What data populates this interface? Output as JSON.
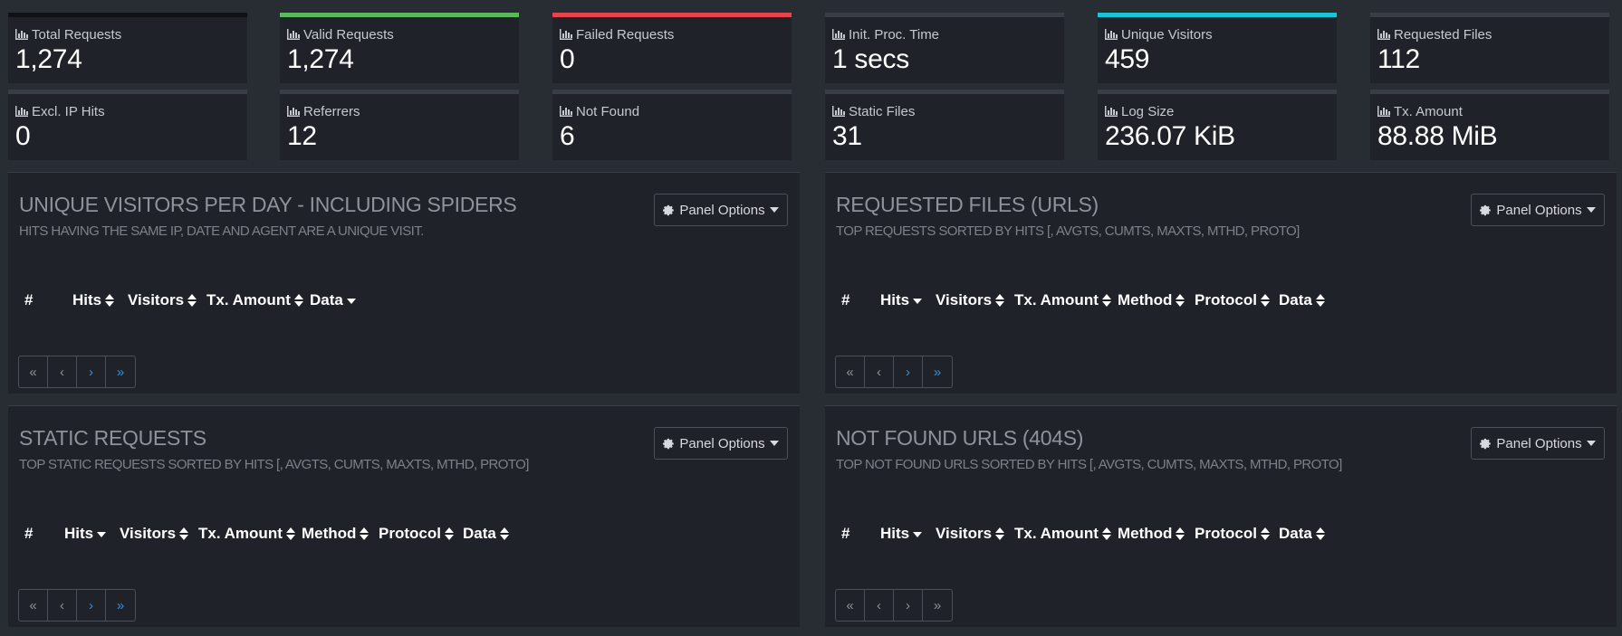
{
  "tiles_left": [
    {
      "label": "Total Requests",
      "value": "1,274",
      "accent": "#0f1115"
    },
    {
      "label": "Valid Requests",
      "value": "1,274",
      "accent": "#5cb85c"
    },
    {
      "label": "Failed Requests",
      "value": "0",
      "accent": "#e8434a"
    },
    {
      "label": "Excl. IP Hits",
      "value": "0",
      "accent": "#393e46"
    },
    {
      "label": "Referrers",
      "value": "12",
      "accent": "#393e46"
    },
    {
      "label": "Not Found",
      "value": "6",
      "accent": "#393e46"
    }
  ],
  "tiles_right": [
    {
      "label": "Init. Proc. Time",
      "value": "1 secs",
      "accent": "#393e46"
    },
    {
      "label": "Unique Visitors",
      "value": "459",
      "accent": "#17c4d9"
    },
    {
      "label": "Requested Files",
      "value": "112",
      "accent": "#393e46"
    },
    {
      "label": "Static Files",
      "value": "31",
      "accent": "#393e46"
    },
    {
      "label": "Log Size",
      "value": "236.07 KiB",
      "accent": "#393e46"
    },
    {
      "label": "Tx. Amount",
      "value": "88.88 MiB",
      "accent": "#393e46"
    }
  ],
  "panels": {
    "visitors": {
      "title": "UNIQUE VISITORS PER DAY - INCLUDING SPIDERS",
      "subtitle": "HITS HAVING THE SAME IP, DATE AND AGENT ARE A UNIQUE VISIT.",
      "options_label": "Panel Options",
      "columns": [
        "#",
        "Hits",
        "Visitors",
        "Tx. Amount",
        "Data"
      ]
    },
    "requests": {
      "title": "REQUESTED FILES (URLS)",
      "subtitle": "TOP REQUESTS SORTED BY HITS [, AVGTS, CUMTS, MAXTS, MTHD, PROTO]",
      "options_label": "Panel Options",
      "columns": [
        "#",
        "Hits",
        "Visitors",
        "Tx. Amount",
        "Method",
        "Protocol",
        "Data"
      ]
    },
    "static": {
      "title": "STATIC REQUESTS",
      "subtitle": "TOP STATIC REQUESTS SORTED BY HITS [, AVGTS, CUMTS, MAXTS, MTHD, PROTO]",
      "options_label": "Panel Options",
      "columns": [
        "#",
        "Hits",
        "Visitors",
        "Tx. Amount",
        "Method",
        "Protocol",
        "Data"
      ]
    },
    "not_found": {
      "title": "NOT FOUND URLS (404S)",
      "subtitle": "TOP NOT FOUND URLS SORTED BY HITS [, AVGTS, CUMTS, MAXTS, MTHD, PROTO]",
      "options_label": "Panel Options",
      "columns": [
        "#",
        "Hits",
        "Visitors",
        "Tx. Amount",
        "Method",
        "Protocol",
        "Data"
      ]
    }
  },
  "pager": {
    "first": "«",
    "prev": "‹",
    "next": "›",
    "last": "»"
  },
  "icons": {
    "tile": "bar-chart-icon",
    "options": "gear-icon",
    "caret": "caret-down-icon",
    "sort": "sort-icon",
    "sort_desc": "sort-desc-icon"
  }
}
